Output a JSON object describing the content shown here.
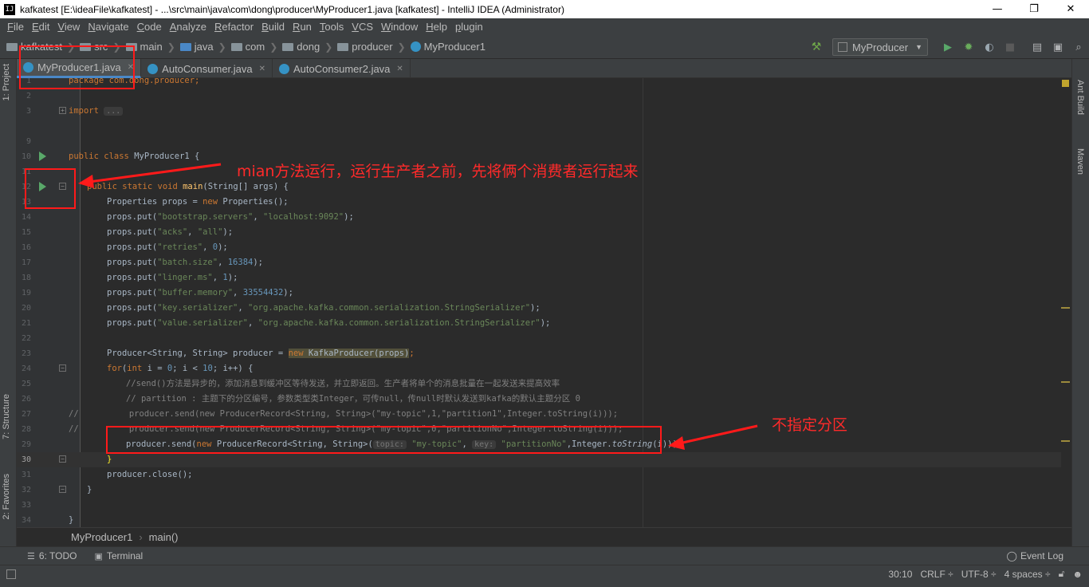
{
  "window": {
    "title": "kafkatest [E:\\ideaFile\\kafkatest] - ...\\src\\main\\java\\com\\dong\\producer\\MyProducer1.java [kafkatest] - IntelliJ IDEA (Administrator)",
    "app_icon": "IJ",
    "minimize": "—",
    "maximize": "❐",
    "close": "✕"
  },
  "menu": [
    "File",
    "Edit",
    "View",
    "Navigate",
    "Code",
    "Analyze",
    "Refactor",
    "Build",
    "Run",
    "Tools",
    "VCS",
    "Window",
    "Help",
    "plugin"
  ],
  "breadcrumbs": [
    "kafkatest",
    "src",
    "main",
    "java",
    "com",
    "dong",
    "producer",
    "MyProducer1"
  ],
  "run_config": "MyProducer",
  "tabs": [
    "MyProducer1.java",
    "AutoConsumer.java",
    "AutoConsumer2.java"
  ],
  "left_tools": [
    "1: Project",
    "7: Structure",
    "2: Favorites"
  ],
  "right_tools": [
    "Ant Build",
    "Maven"
  ],
  "code": {
    "l1": "package com.dong.producer;",
    "l3": "import",
    "l3_fold": "...",
    "l10_kw": "public class ",
    "l10_rest": "MyProducer1 {",
    "l12_kw": "public static void ",
    "l12_fn": "main",
    "l12_rest": "(String[] args) {",
    "l13a": "Properties props = ",
    "l13_kw": "new ",
    "l13b": "Properties();",
    "props": [
      {
        "pre": "props.put(",
        "k": "\"bootstrap.servers\"",
        "mid": ", ",
        "v": "\"localhost:9092\"",
        "post": ");",
        "ln": "14",
        "vtype": "str"
      },
      {
        "pre": "props.put(",
        "k": "\"acks\"",
        "mid": ", ",
        "v": "\"all\"",
        "post": ");",
        "ln": "15",
        "vtype": "str"
      },
      {
        "pre": "props.put(",
        "k": "\"retries\"",
        "mid": ", ",
        "v": "0",
        "post": ");",
        "ln": "16",
        "vtype": "num"
      },
      {
        "pre": "props.put(",
        "k": "\"batch.size\"",
        "mid": ", ",
        "v": "16384",
        "post": ");",
        "ln": "17",
        "vtype": "num"
      },
      {
        "pre": "props.put(",
        "k": "\"linger.ms\"",
        "mid": ", ",
        "v": "1",
        "post": ");",
        "ln": "18",
        "vtype": "num"
      },
      {
        "pre": "props.put(",
        "k": "\"buffer.memory\"",
        "mid": ", ",
        "v": "33554432",
        "post": ");",
        "ln": "19",
        "vtype": "num"
      },
      {
        "pre": "props.put(",
        "k": "\"key.serializer\"",
        "mid": ", ",
        "v": "\"org.apache.kafka.common.serialization.StringSerializer\"",
        "post": ");",
        "ln": "20",
        "vtype": "str"
      },
      {
        "pre": "props.put(",
        "k": "\"value.serializer\"",
        "mid": ", ",
        "v": "\"org.apache.kafka.common.serialization.StringSerializer\"",
        "post": ");",
        "ln": "21",
        "vtype": "str"
      }
    ],
    "l23a": "Producer<String, String> producer = ",
    "l23_kw": "new ",
    "l23b": "KafkaProducer(props)",
    "l23c": ";",
    "l24_kw": "for",
    "l24a": "(",
    "l24_kw2": "int ",
    "l24b": "i = ",
    "l24_n0": "0",
    "l24c": "; i < ",
    "l24_n10": "10",
    "l24d": "; i++) {",
    "l25": "//send()方法是异步的，添加消息到缓冲区等待发送，并立即返回。生产者将单个的消息批量在一起发送来提高效率",
    "l26": "// partition : 主题下的分区编号，参数类型类Integer，可传null，传null时默认发送到kafka的默认主题分区 0",
    "l27": "//          producer.send(new ProducerRecord<String, String>(\"my-topic\",1,\"partition1\",Integer.toString(i)));",
    "l28": "//          producer.send(new ProducerRecord<String, String>(\"my-topic\",0,\"partitionNo\",Integer.toString(i)));",
    "l29a": "producer.send(",
    "l29_kw": "new ",
    "l29b": "ProducerRecord<String, String>(",
    "l29_hint1": "topic:",
    "l29_s1": "\"my-topic\"",
    "l29c": ", ",
    "l29_hint2": "key:",
    "l29_s2": "\"partitionNo\"",
    "l29d": ",Integer.",
    "l29_it": "toString",
    "l29e": "(i)));",
    "l30": "}",
    "l31": "producer.close();",
    "l32": "}",
    "l34": "}"
  },
  "line_numbers": [
    "1",
    "2",
    "3",
    "9",
    "10",
    "11",
    "12",
    "13",
    "22",
    "23",
    "24",
    "25",
    "26",
    "27",
    "28",
    "29",
    "30",
    "31",
    "32",
    "33",
    "34"
  ],
  "editor_breadcrumb": [
    "MyProducer1",
    "main()"
  ],
  "bottom_tools": {
    "todo": "6: TODO",
    "terminal": "Terminal",
    "event_log": "Event Log"
  },
  "status": {
    "position": "30:10",
    "line_sep": "CRLF ÷",
    "encoding": "UTF-8 ÷",
    "indent": "4 spaces ÷"
  },
  "annotations": {
    "main_note": "mian方法运行，运行生产者之前，先将俩个消费者运行起来",
    "partition_note": "不指定分区",
    "color": "#ff1a1a"
  }
}
